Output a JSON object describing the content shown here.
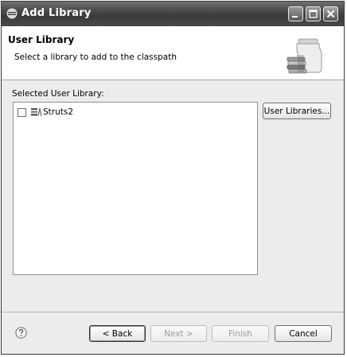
{
  "window": {
    "title": "Add Library",
    "controls": {
      "minimize": "minimize-icon",
      "maximize": "maximize-icon",
      "close": "close-icon"
    }
  },
  "header": {
    "title": "User Library",
    "description": "Select a library to add to the classpath"
  },
  "main": {
    "list_label": "Selected User Library:",
    "libraries": [
      {
        "label": "Struts2",
        "checked": false,
        "icon": "library-icon"
      }
    ],
    "user_libraries_button": "User Libraries..."
  },
  "footer": {
    "help_icon": "help-icon",
    "back_label": "< Back",
    "next_label": "Next >",
    "finish_label": "Finish",
    "cancel_label": "Cancel",
    "next_enabled": false,
    "finish_enabled": false
  },
  "colors": {
    "titlebar": "#3a3a3a",
    "dialog_background": "#ececec",
    "disabled_text": "#9b9b9b"
  }
}
